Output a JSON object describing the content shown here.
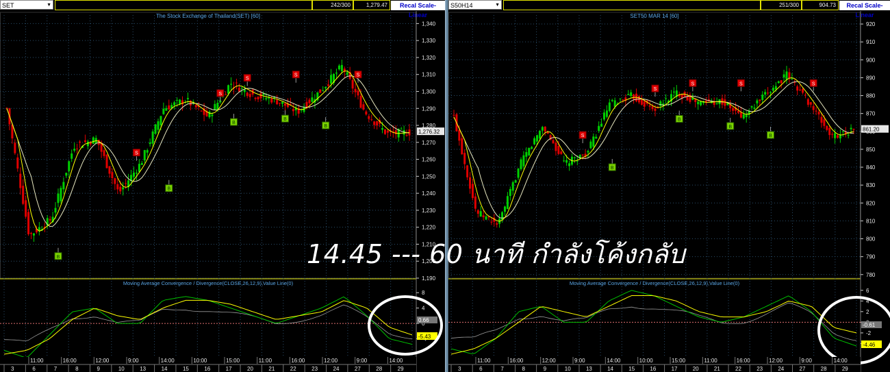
{
  "left": {
    "symbol": "SET",
    "box_counter": "242/300",
    "box_last": "1,279.47",
    "recal_label": "Recal Scale-Linear",
    "price_title": "The Stock Exchange of Thailand(SET) [60]",
    "macd_title": "Moving Average Convergence / Divergence(CLOSE,26,12,9),Value Line(0)",
    "last_price_label": "1,276.32",
    "price_ticks": [
      "1,340",
      "1,330",
      "1,320",
      "1,310",
      "1,300",
      "1,290",
      "1,280",
      "1,270",
      "1,260",
      "1,250",
      "1,240",
      "1,230",
      "1,220",
      "1,210",
      "1,200",
      "1,190"
    ],
    "macd_ticks": [
      "8",
      "4",
      "0",
      "-4"
    ],
    "macd_value_1": "0.66",
    "macd_value_2": "-5.43",
    "time_labels": [
      "11:00",
      "16:00",
      "12:00",
      "9:00",
      "14:00",
      "10:00",
      "15:00",
      "11:00",
      "16:00",
      "12:00",
      "9:00",
      "14:00"
    ],
    "date_labels": [
      "3",
      "6",
      "7",
      "8",
      "9",
      "10",
      "13",
      "14",
      "15",
      "16",
      "17",
      "20",
      "21",
      "22",
      "23",
      "24",
      "27",
      "28",
      "29"
    ],
    "buy_label": "B",
    "sell_label": "S"
  },
  "right": {
    "symbol": "S50H14",
    "box_counter": "251/300",
    "box_last": "904.73",
    "recal_label": "Recal Scale-Linear",
    "price_title": "SET50 MAR 14  [60]",
    "macd_title": "Moving Average Convergence / Divergence(CLOSE,26,12,9),Value Line(0)",
    "last_price_label": "861.20",
    "price_ticks": [
      "920",
      "910",
      "900",
      "890",
      "880",
      "870",
      "860",
      "850",
      "840",
      "830",
      "820",
      "810",
      "800",
      "790",
      "780"
    ],
    "macd_ticks": [
      "6",
      "4",
      "2",
      "0",
      "-2",
      "-4"
    ],
    "macd_value_1": "-0.61",
    "macd_value_2": "-4.46",
    "time_labels": [
      "11:00",
      "16:00",
      "12:00",
      "9:00",
      "14:00",
      "10:00",
      "15:00",
      "11:00",
      "16:00",
      "12:00",
      "9:00",
      "14:00"
    ],
    "date_labels": [
      "3",
      "6",
      "7",
      "8",
      "9",
      "10",
      "13",
      "14",
      "15",
      "16",
      "17",
      "20",
      "21",
      "22",
      "23",
      "24",
      "27",
      "28",
      "29"
    ],
    "buy_label": "B",
    "sell_label": "S"
  },
  "overlay_text": "14.45 --- 60 นาที กำลังโค้งกลับ",
  "colors": {
    "up": "#00d000",
    "down": "#e00000",
    "ma_fast": "#ffff00",
    "ma_slow": "#e8e8c0",
    "macd": "#00c000",
    "signal": "#ffff00",
    "grid": "#2a4d6a",
    "axis": "#e0e000"
  },
  "chart_data": [
    {
      "type": "line",
      "title": "The Stock Exchange of Thailand(SET) [60]",
      "xlabel": "",
      "ylabel": "",
      "ylim": [
        1190,
        1345
      ],
      "grid": true,
      "x": [
        "3",
        "6",
        "7",
        "8",
        "9",
        "10",
        "13",
        "14",
        "15",
        "16",
        "17",
        "20",
        "21",
        "22",
        "23",
        "24",
        "27",
        "28",
        "29"
      ],
      "series": [
        {
          "name": "SET",
          "values": [
            1290,
            1215,
            1225,
            1268,
            1272,
            1240,
            1258,
            1290,
            1295,
            1285,
            1305,
            1298,
            1295,
            1288,
            1300,
            1315,
            1288,
            1275,
            1276
          ]
        }
      ],
      "last": 1276.32
    },
    {
      "type": "line",
      "title": "Moving Average Convergence / Divergence(CLOSE,26,12,9),Value Line(0)",
      "ylim": [
        -8,
        10
      ],
      "x": [
        "3",
        "6",
        "7",
        "8",
        "9",
        "10",
        "13",
        "14",
        "15",
        "16",
        "17",
        "20",
        "21",
        "22",
        "23",
        "24",
        "27",
        "28",
        "29"
      ],
      "series": [
        {
          "name": "",
          "values": [
            -7,
            -9,
            -3,
            3,
            4,
            0,
            0,
            6,
            7,
            6,
            4,
            2,
            0,
            2,
            4,
            7,
            2,
            -4,
            -5.43
          ]
        },
        {
          "name": "",
          "values": [
            -8,
            -7,
            -4,
            1,
            4,
            2,
            1,
            4,
            6,
            6,
            5,
            3,
            1,
            2,
            3,
            6,
            4,
            -1,
            -3
          ]
        }
      ]
    },
    {
      "type": "line",
      "title": "SET50 MAR 14  [60]",
      "ylim": [
        778,
        925
      ],
      "grid": true,
      "x": [
        "3",
        "6",
        "7",
        "8",
        "9",
        "10",
        "13",
        "14",
        "15",
        "16",
        "17",
        "20",
        "21",
        "22",
        "23",
        "24",
        "27",
        "28",
        "29"
      ],
      "series": [
        {
          "name": "S50H14",
          "values": [
            868,
            815,
            808,
            842,
            863,
            842,
            848,
            875,
            880,
            872,
            882,
            876,
            877,
            868,
            880,
            892,
            876,
            857,
            861
          ]
        }
      ],
      "last": 861.2
    },
    {
      "type": "line",
      "title": "Moving Average Convergence / Divergence(CLOSE,26,12,9),Value Line(0)",
      "ylim": [
        -6,
        7
      ],
      "x": [
        "3",
        "6",
        "7",
        "8",
        "9",
        "10",
        "13",
        "14",
        "15",
        "16",
        "17",
        "20",
        "21",
        "22",
        "23",
        "24",
        "27",
        "28",
        "29"
      ],
      "series": [
        {
          "name": "",
          "values": [
            -5,
            -6,
            -3,
            2,
            3,
            0,
            0,
            4,
            6,
            5,
            3,
            1,
            0,
            1,
            3,
            5,
            2,
            -3,
            -4.46
          ]
        },
        {
          "name": "",
          "values": [
            -6,
            -5,
            -3,
            0,
            3,
            2,
            1,
            3,
            5,
            5,
            4,
            2,
            1,
            1,
            2,
            4,
            3,
            -1,
            -2
          ]
        }
      ]
    }
  ]
}
